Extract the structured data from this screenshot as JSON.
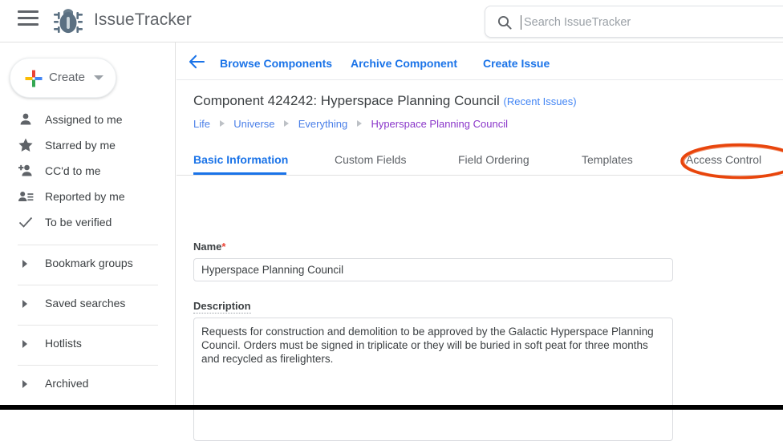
{
  "header": {
    "brand": "IssueTracker",
    "menu_icon": "hamburger-menu-icon",
    "logo_icon": "bug-logo-icon",
    "search": {
      "icon": "search-icon",
      "placeholder": "Search IssueTracker",
      "value": ""
    }
  },
  "sidebar": {
    "create": {
      "label": "Create",
      "plus_icon": "colored-plus-icon",
      "caret_icon": "chevron-down-icon"
    },
    "quick_links": [
      {
        "label": "Assigned to me",
        "icon": "person-icon"
      },
      {
        "label": "Starred by me",
        "icon": "star-icon"
      },
      {
        "label": "CC'd to me",
        "icon": "person-add-icon"
      },
      {
        "label": "Reported by me",
        "icon": "person-list-icon"
      },
      {
        "label": "To be verified",
        "icon": "check-icon"
      }
    ],
    "groups": [
      {
        "label": "Bookmark groups",
        "icon": "triangle-right-icon"
      },
      {
        "label": "Saved searches",
        "icon": "triangle-right-icon"
      },
      {
        "label": "Hotlists",
        "icon": "triangle-right-icon"
      },
      {
        "label": "Archived",
        "icon": "triangle-right-icon"
      }
    ]
  },
  "main": {
    "back_icon": "arrow-left-icon",
    "actions": [
      {
        "label": "Browse Components"
      },
      {
        "label": "Archive Component"
      },
      {
        "label": "Create Issue"
      }
    ],
    "title": "Component 424242: Hyperspace Planning Council",
    "title_link": "(Recent Issues)",
    "breadcrumb": [
      {
        "label": "Life",
        "current": false
      },
      {
        "label": "Universe",
        "current": false
      },
      {
        "label": "Everything",
        "current": false
      },
      {
        "label": "Hyperspace Planning Council",
        "current": true
      }
    ],
    "tabs": [
      {
        "label": "Basic Information",
        "active": true
      },
      {
        "label": "Custom Fields",
        "active": false
      },
      {
        "label": "Field Ordering",
        "active": false
      },
      {
        "label": "Templates",
        "active": false
      },
      {
        "label": "Access Control",
        "active": false,
        "annotated": true
      }
    ],
    "form": {
      "name_label": "Name",
      "name_required_marker": "*",
      "name_value": "Hyperspace Planning Council",
      "description_label": "Description",
      "description_value": "Requests for construction and demolition to be approved by the Galactic Hyperspace Planning Council. Orders must be signed in triplicate or they will be buried in soft peat for three months and recycled as firelighters."
    }
  },
  "colors": {
    "accent_blue": "#1a73e8",
    "link_blue": "#4a7fe8",
    "visited_purple": "#8a36c9",
    "required_red": "#ea4335",
    "annotation_orange": "#e8450c",
    "logo_slate": "#5b7082"
  }
}
